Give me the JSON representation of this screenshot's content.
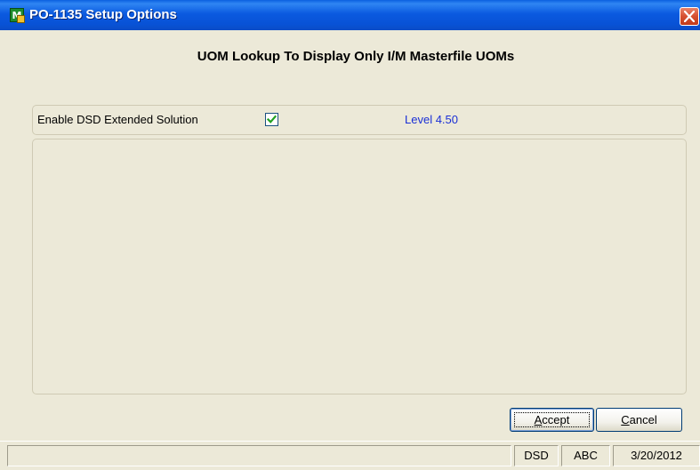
{
  "window": {
    "title": "PO-1135 Setup Options",
    "icon": "sage-mas-app-icon",
    "icon_glyph": "M",
    "close_icon": "close-x-icon"
  },
  "heading": "UOM Lookup To Display Only I/M Masterfile UOMs",
  "options": {
    "enable_label": "Enable DSD Extended Solution",
    "enable_checked": true,
    "level_text": "Level  4.50"
  },
  "buttons": {
    "accept_mnemonic": "A",
    "accept_rest": "ccept",
    "cancel_mnemonic": "C",
    "cancel_rest": "ancel"
  },
  "statusbar": {
    "main": "",
    "company_code": "DSD",
    "company_abbrev": "ABC",
    "date": "3/20/2012"
  },
  "colors": {
    "titlebar": "#0a5fe0",
    "level_text": "#1a2fd6",
    "dialog_bg": "#ece9d8",
    "close_button": "#d6502f"
  }
}
